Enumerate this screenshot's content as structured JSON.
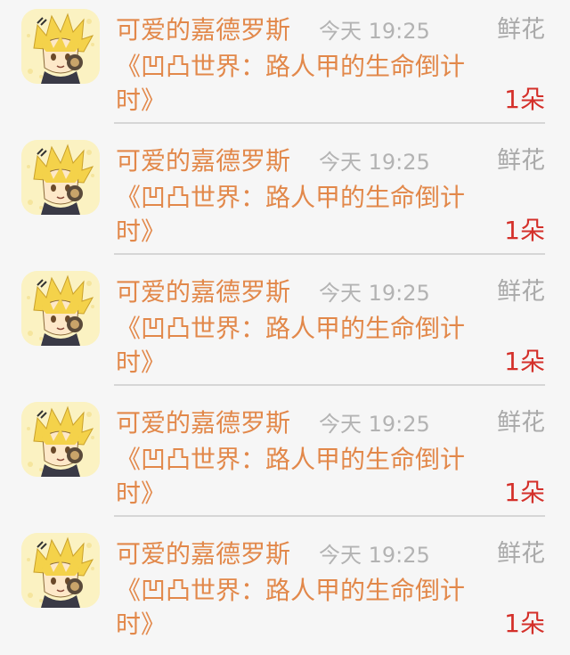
{
  "colors": {
    "name": "#e2884a",
    "time": "#b3b3b3",
    "gift_label": "#a9a9a9",
    "count": "#d4302a",
    "divider": "#d6d6d6",
    "avatar_bg": "#fbf2c2"
  },
  "items": [
    {
      "avatar_icon": "anime-avatar-icon",
      "user": "可爱的嘉德罗斯",
      "time": "今天 19:25",
      "gift": "鲜花",
      "book": "《凹凸世界：路人甲的生命倒计时》",
      "count": "1朵"
    },
    {
      "avatar_icon": "anime-avatar-icon",
      "user": "可爱的嘉德罗斯",
      "time": "今天 19:25",
      "gift": "鲜花",
      "book": "《凹凸世界：路人甲的生命倒计时》",
      "count": "1朵"
    },
    {
      "avatar_icon": "anime-avatar-icon",
      "user": "可爱的嘉德罗斯",
      "time": "今天 19:25",
      "gift": "鲜花",
      "book": "《凹凸世界：路人甲的生命倒计时》",
      "count": "1朵"
    },
    {
      "avatar_icon": "anime-avatar-icon",
      "user": "可爱的嘉德罗斯",
      "time": "今天 19:25",
      "gift": "鲜花",
      "book": "《凹凸世界：路人甲的生命倒计时》",
      "count": "1朵"
    },
    {
      "avatar_icon": "anime-avatar-icon",
      "user": "可爱的嘉德罗斯",
      "time": "今天 19:25",
      "gift": "鲜花",
      "book": "《凹凸世界：路人甲的生命倒计时》",
      "count": "1朵"
    }
  ]
}
